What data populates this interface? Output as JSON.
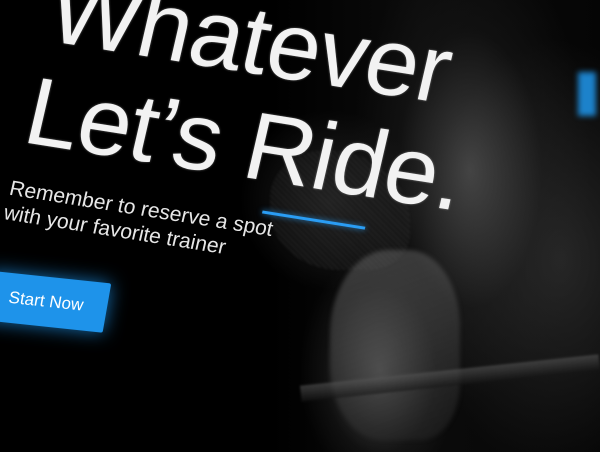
{
  "hero": {
    "headline_line1": "Whatever",
    "headline_line2": "Let’s Ride.",
    "subtitle_line1": "Remember to reserve a spot",
    "subtitle_line2": "with your favorite trainer",
    "cta_label": "Start Now"
  },
  "colors": {
    "accent": "#1e93ea",
    "background": "#000000",
    "text": "#f2f2f2"
  }
}
